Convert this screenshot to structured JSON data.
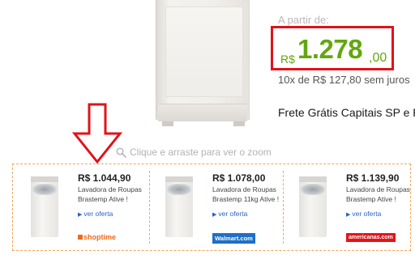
{
  "product": {
    "price_label": "A partir de:",
    "currency": "R$",
    "price_integer": "1.278",
    "price_cents": ",00",
    "installments": "10x de R$ 127,80 sem juros",
    "shipping": "Frete Grátis Capitais SP e RJ"
  },
  "zoom_hint": "Clique e arraste para ver o zoom",
  "colors": {
    "price_green": "#62a70f",
    "highlight_red": "#e0131a",
    "strip_border_orange": "#f2a65a",
    "link_blue": "#2a62c9"
  },
  "offers": [
    {
      "price": "R$ 1.044,90",
      "title": "Lavadora de Roupas Brastemp Ative !",
      "link": "ver oferta",
      "store": "shoptime",
      "store_logo_icon": "shoptime-logo"
    },
    {
      "price": "R$ 1.078,00",
      "title": "Lavadora de Roupas Brastemp 11kg Ative !",
      "link": "ver oferta",
      "store": "Walmart.com",
      "store_logo_icon": "walmart-logo"
    },
    {
      "price": "R$ 1.139,90",
      "title": "Lavadora de Roupas Brastemp Ative !",
      "link": "ver oferta",
      "store": "americanas.com",
      "store_logo_icon": "americanas-logo"
    }
  ]
}
